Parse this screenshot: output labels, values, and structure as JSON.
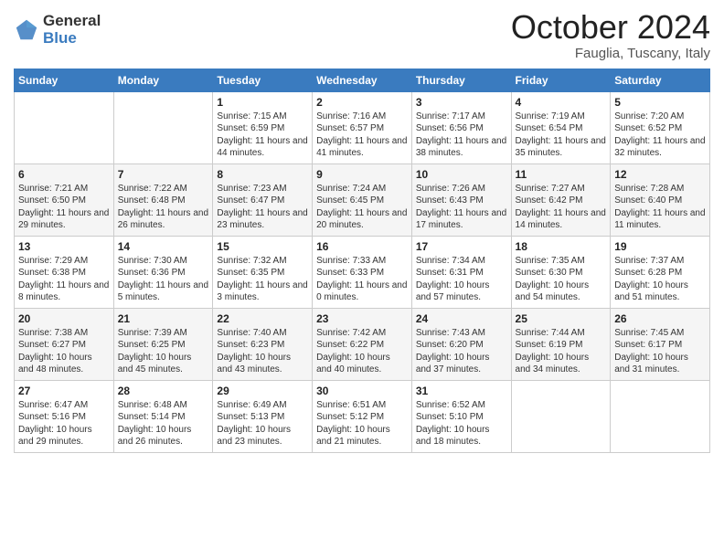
{
  "header": {
    "logo": {
      "general": "General",
      "blue": "Blue"
    },
    "title": "October 2024",
    "location": "Fauglia, Tuscany, Italy"
  },
  "days_of_week": [
    "Sunday",
    "Monday",
    "Tuesday",
    "Wednesday",
    "Thursday",
    "Friday",
    "Saturday"
  ],
  "weeks": [
    [
      {
        "num": "",
        "text": ""
      },
      {
        "num": "",
        "text": ""
      },
      {
        "num": "1",
        "text": "Sunrise: 7:15 AM\nSunset: 6:59 PM\nDaylight: 11 hours and 44 minutes."
      },
      {
        "num": "2",
        "text": "Sunrise: 7:16 AM\nSunset: 6:57 PM\nDaylight: 11 hours and 41 minutes."
      },
      {
        "num": "3",
        "text": "Sunrise: 7:17 AM\nSunset: 6:56 PM\nDaylight: 11 hours and 38 minutes."
      },
      {
        "num": "4",
        "text": "Sunrise: 7:19 AM\nSunset: 6:54 PM\nDaylight: 11 hours and 35 minutes."
      },
      {
        "num": "5",
        "text": "Sunrise: 7:20 AM\nSunset: 6:52 PM\nDaylight: 11 hours and 32 minutes."
      }
    ],
    [
      {
        "num": "6",
        "text": "Sunrise: 7:21 AM\nSunset: 6:50 PM\nDaylight: 11 hours and 29 minutes."
      },
      {
        "num": "7",
        "text": "Sunrise: 7:22 AM\nSunset: 6:48 PM\nDaylight: 11 hours and 26 minutes."
      },
      {
        "num": "8",
        "text": "Sunrise: 7:23 AM\nSunset: 6:47 PM\nDaylight: 11 hours and 23 minutes."
      },
      {
        "num": "9",
        "text": "Sunrise: 7:24 AM\nSunset: 6:45 PM\nDaylight: 11 hours and 20 minutes."
      },
      {
        "num": "10",
        "text": "Sunrise: 7:26 AM\nSunset: 6:43 PM\nDaylight: 11 hours and 17 minutes."
      },
      {
        "num": "11",
        "text": "Sunrise: 7:27 AM\nSunset: 6:42 PM\nDaylight: 11 hours and 14 minutes."
      },
      {
        "num": "12",
        "text": "Sunrise: 7:28 AM\nSunset: 6:40 PM\nDaylight: 11 hours and 11 minutes."
      }
    ],
    [
      {
        "num": "13",
        "text": "Sunrise: 7:29 AM\nSunset: 6:38 PM\nDaylight: 11 hours and 8 minutes."
      },
      {
        "num": "14",
        "text": "Sunrise: 7:30 AM\nSunset: 6:36 PM\nDaylight: 11 hours and 5 minutes."
      },
      {
        "num": "15",
        "text": "Sunrise: 7:32 AM\nSunset: 6:35 PM\nDaylight: 11 hours and 3 minutes."
      },
      {
        "num": "16",
        "text": "Sunrise: 7:33 AM\nSunset: 6:33 PM\nDaylight: 11 hours and 0 minutes."
      },
      {
        "num": "17",
        "text": "Sunrise: 7:34 AM\nSunset: 6:31 PM\nDaylight: 10 hours and 57 minutes."
      },
      {
        "num": "18",
        "text": "Sunrise: 7:35 AM\nSunset: 6:30 PM\nDaylight: 10 hours and 54 minutes."
      },
      {
        "num": "19",
        "text": "Sunrise: 7:37 AM\nSunset: 6:28 PM\nDaylight: 10 hours and 51 minutes."
      }
    ],
    [
      {
        "num": "20",
        "text": "Sunrise: 7:38 AM\nSunset: 6:27 PM\nDaylight: 10 hours and 48 minutes."
      },
      {
        "num": "21",
        "text": "Sunrise: 7:39 AM\nSunset: 6:25 PM\nDaylight: 10 hours and 45 minutes."
      },
      {
        "num": "22",
        "text": "Sunrise: 7:40 AM\nSunset: 6:23 PM\nDaylight: 10 hours and 43 minutes."
      },
      {
        "num": "23",
        "text": "Sunrise: 7:42 AM\nSunset: 6:22 PM\nDaylight: 10 hours and 40 minutes."
      },
      {
        "num": "24",
        "text": "Sunrise: 7:43 AM\nSunset: 6:20 PM\nDaylight: 10 hours and 37 minutes."
      },
      {
        "num": "25",
        "text": "Sunrise: 7:44 AM\nSunset: 6:19 PM\nDaylight: 10 hours and 34 minutes."
      },
      {
        "num": "26",
        "text": "Sunrise: 7:45 AM\nSunset: 6:17 PM\nDaylight: 10 hours and 31 minutes."
      }
    ],
    [
      {
        "num": "27",
        "text": "Sunrise: 6:47 AM\nSunset: 5:16 PM\nDaylight: 10 hours and 29 minutes."
      },
      {
        "num": "28",
        "text": "Sunrise: 6:48 AM\nSunset: 5:14 PM\nDaylight: 10 hours and 26 minutes."
      },
      {
        "num": "29",
        "text": "Sunrise: 6:49 AM\nSunset: 5:13 PM\nDaylight: 10 hours and 23 minutes."
      },
      {
        "num": "30",
        "text": "Sunrise: 6:51 AM\nSunset: 5:12 PM\nDaylight: 10 hours and 21 minutes."
      },
      {
        "num": "31",
        "text": "Sunrise: 6:52 AM\nSunset: 5:10 PM\nDaylight: 10 hours and 18 minutes."
      },
      {
        "num": "",
        "text": ""
      },
      {
        "num": "",
        "text": ""
      }
    ]
  ]
}
